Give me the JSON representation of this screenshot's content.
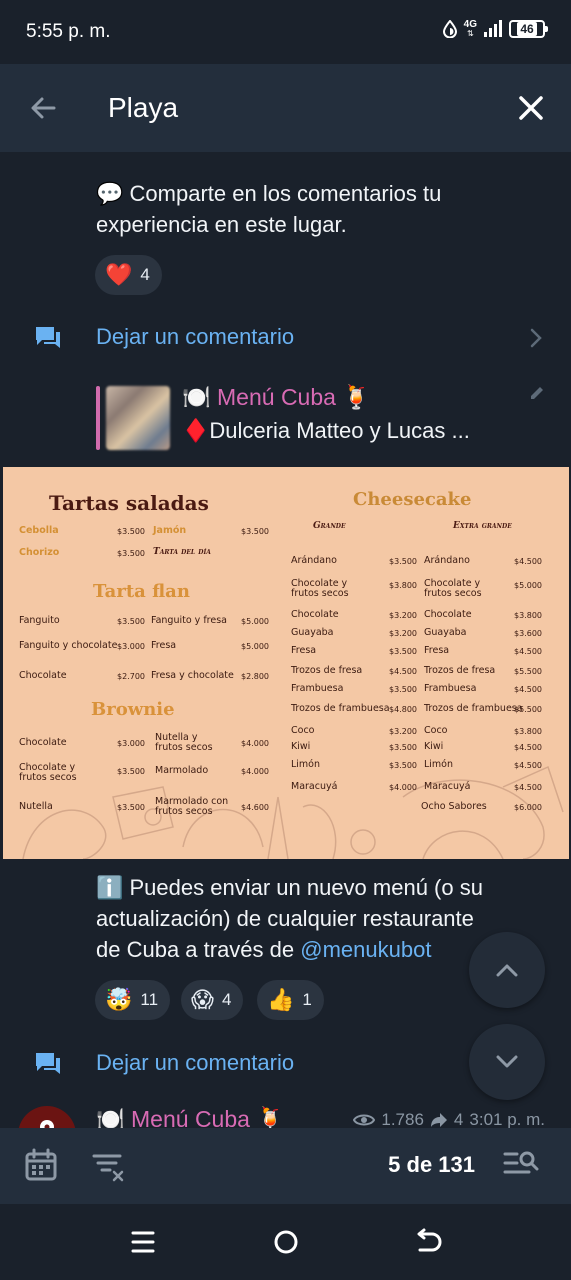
{
  "status_bar": {
    "time": "5:55 p. m.",
    "network": "4G",
    "battery": "46"
  },
  "app_bar": {
    "title": "Playa"
  },
  "messages": {
    "first": {
      "emoji": "💬",
      "line1": "Comparte en los comentarios tu",
      "line2": "experiencia en este lugar.",
      "reaction": {
        "emoji": "❤️",
        "count": "4"
      }
    },
    "comment_label": "Dejar un comentario",
    "reply": {
      "name": "🍽️ Menú Cuba 🍹",
      "text": "♦️Dulceria Matteo y Lucas ..."
    },
    "second": {
      "line1": "ℹ️  Puedes enviar un nuevo menú (o su",
      "line2": "actualización) de cualquier restaurante",
      "line3_prefix": "de Cuba a través de ",
      "line3_link": "@menukubot",
      "reactions": [
        {
          "emoji": "🤯",
          "count": "11"
        },
        {
          "emoji": "😱",
          "count": "4"
        },
        {
          "emoji": "👍",
          "count": "1"
        }
      ]
    },
    "next": {
      "name": "🍽️ Menú Cuba 🍹",
      "views": "1.786",
      "shares": "4",
      "time": "3:01 p. m."
    }
  },
  "menu_image": {
    "tartas_saladas": {
      "title": "Tartas saladas",
      "items": [
        {
          "name": "Cebolla",
          "price": "$3.500"
        },
        {
          "name": "Jamón",
          "price": "$3.500"
        },
        {
          "name": "Chorizo",
          "price": "$3.500"
        },
        {
          "name": "Tarta del día",
          "price": ""
        }
      ]
    },
    "tarta_flan": {
      "title": "Tarta flan",
      "items": [
        {
          "name": "Fanguito",
          "price": "$3.500"
        },
        {
          "name": "Fanguito y fresa",
          "price": "$5.000"
        },
        {
          "name": "Fanguito y chocolate",
          "price": "$3.000"
        },
        {
          "name": "Fresa",
          "price": "$5.000"
        },
        {
          "name": "Chocolate",
          "price": "$2.700"
        },
        {
          "name": "Fresa y chocolate",
          "price": "$2.800"
        }
      ]
    },
    "brownie": {
      "title": "Brownie",
      "items": [
        {
          "name": "Chocolate",
          "price": "$3.000"
        },
        {
          "name": "Nutella y frutos secos",
          "price": "$4.000"
        },
        {
          "name": "Chocolate y frutos secos",
          "price": "$3.500"
        },
        {
          "name": "Marmolado",
          "price": "$4.000"
        },
        {
          "name": "Nutella",
          "price": "$3.500"
        },
        {
          "name": "Marmolado con frutos secos",
          "price": "$4.600"
        }
      ]
    },
    "cheesecake": {
      "title": "Cheesecake",
      "col1": "Grande",
      "col2": "Extra grande",
      "grande": [
        {
          "name": "Arándano",
          "price": "$3.500"
        },
        {
          "name": "Chocolate y frutos secos",
          "price": "$3.800"
        },
        {
          "name": "Chocolate",
          "price": "$3.200"
        },
        {
          "name": "Guayaba",
          "price": "$3.200"
        },
        {
          "name": "Fresa",
          "price": "$3.500"
        },
        {
          "name": "Trozos de fresa",
          "price": "$4.500"
        },
        {
          "name": "Frambuesa",
          "price": "$3.500"
        },
        {
          "name": "Trozos de frambuesa",
          "price": "$4.800"
        },
        {
          "name": "Coco",
          "price": "$3.200"
        },
        {
          "name": "Kiwi",
          "price": "$3.500"
        },
        {
          "name": "Limón",
          "price": "$3.500"
        },
        {
          "name": "Maracuyá",
          "price": "$4.000"
        }
      ],
      "extra": [
        {
          "name": "Arándano",
          "price": "$4.500"
        },
        {
          "name": "Chocolate y frutos secos",
          "price": "$5.000"
        },
        {
          "name": "Chocolate",
          "price": "$3.800"
        },
        {
          "name": "Guayaba",
          "price": "$3.600"
        },
        {
          "name": "Fresa",
          "price": "$4.500"
        },
        {
          "name": "Trozos de fresa",
          "price": "$5.500"
        },
        {
          "name": "Frambuesa",
          "price": "$4.500"
        },
        {
          "name": "Trozos de frambuesa",
          "price": "$5.500"
        },
        {
          "name": "Coco",
          "price": "$3.800"
        },
        {
          "name": "Kiwi",
          "price": "$4.500"
        },
        {
          "name": "Limón",
          "price": "$4.500"
        },
        {
          "name": "Maracuyá",
          "price": "$4.500"
        },
        {
          "name": "Ocho Sabores",
          "price": "$6.000"
        }
      ]
    }
  },
  "bottom_bar": {
    "counter": "5 de 131"
  }
}
